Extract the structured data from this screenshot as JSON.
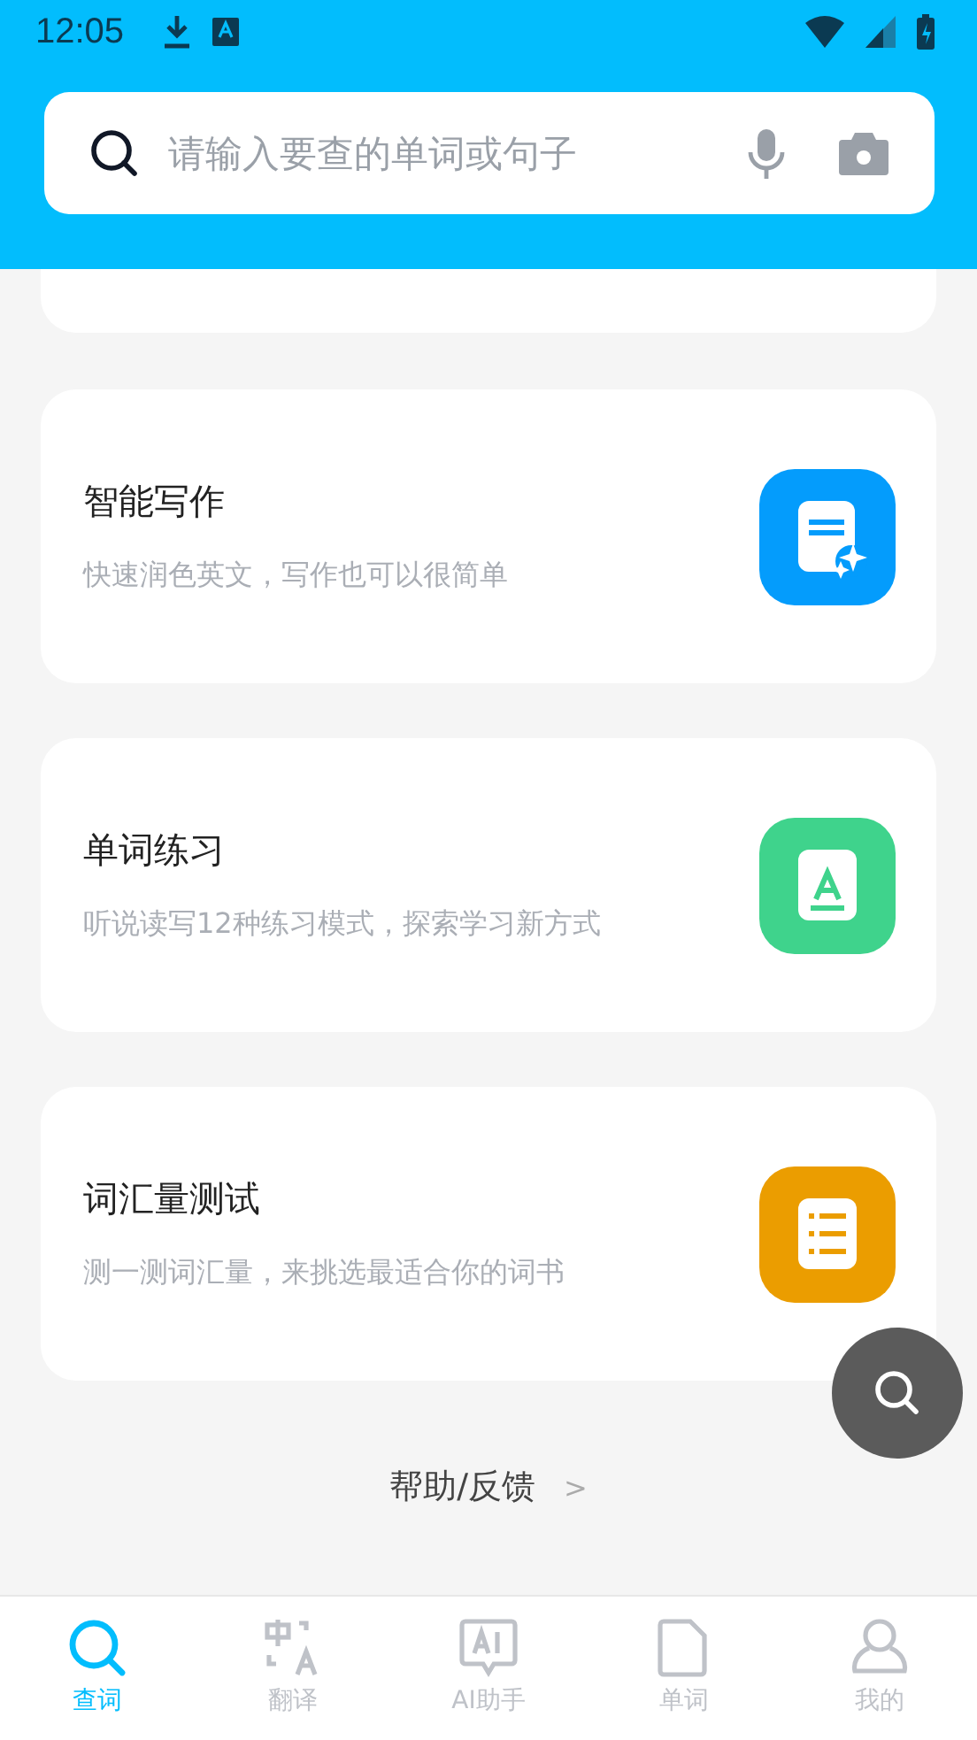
{
  "status_bar": {
    "time": "12:05"
  },
  "search": {
    "placeholder": "请输入要查的单词或句子"
  },
  "cards": [
    {
      "kind": "write",
      "title": "智能写作",
      "subtitle": "快速润色英文，写作也可以很简单",
      "color": "#049cfc"
    },
    {
      "kind": "practice",
      "title": "单词练习",
      "subtitle": "听说读写12种练习模式，探索学习新方式",
      "color": "#3fd38c"
    },
    {
      "kind": "test",
      "title": "词汇量测试",
      "subtitle": "测一测词汇量，来挑选最适合你的词书",
      "color": "#eb9d00"
    }
  ],
  "help": {
    "label": "帮助/反馈",
    "arrow": ">"
  },
  "tabs": [
    {
      "kind": "search",
      "label": "查词",
      "selected": true
    },
    {
      "kind": "translate",
      "label": "翻译",
      "selected": false
    },
    {
      "kind": "ai",
      "label": "AI助手",
      "selected": false
    },
    {
      "kind": "words",
      "label": "单词",
      "selected": false
    },
    {
      "kind": "me",
      "label": "我的",
      "selected": false
    }
  ]
}
